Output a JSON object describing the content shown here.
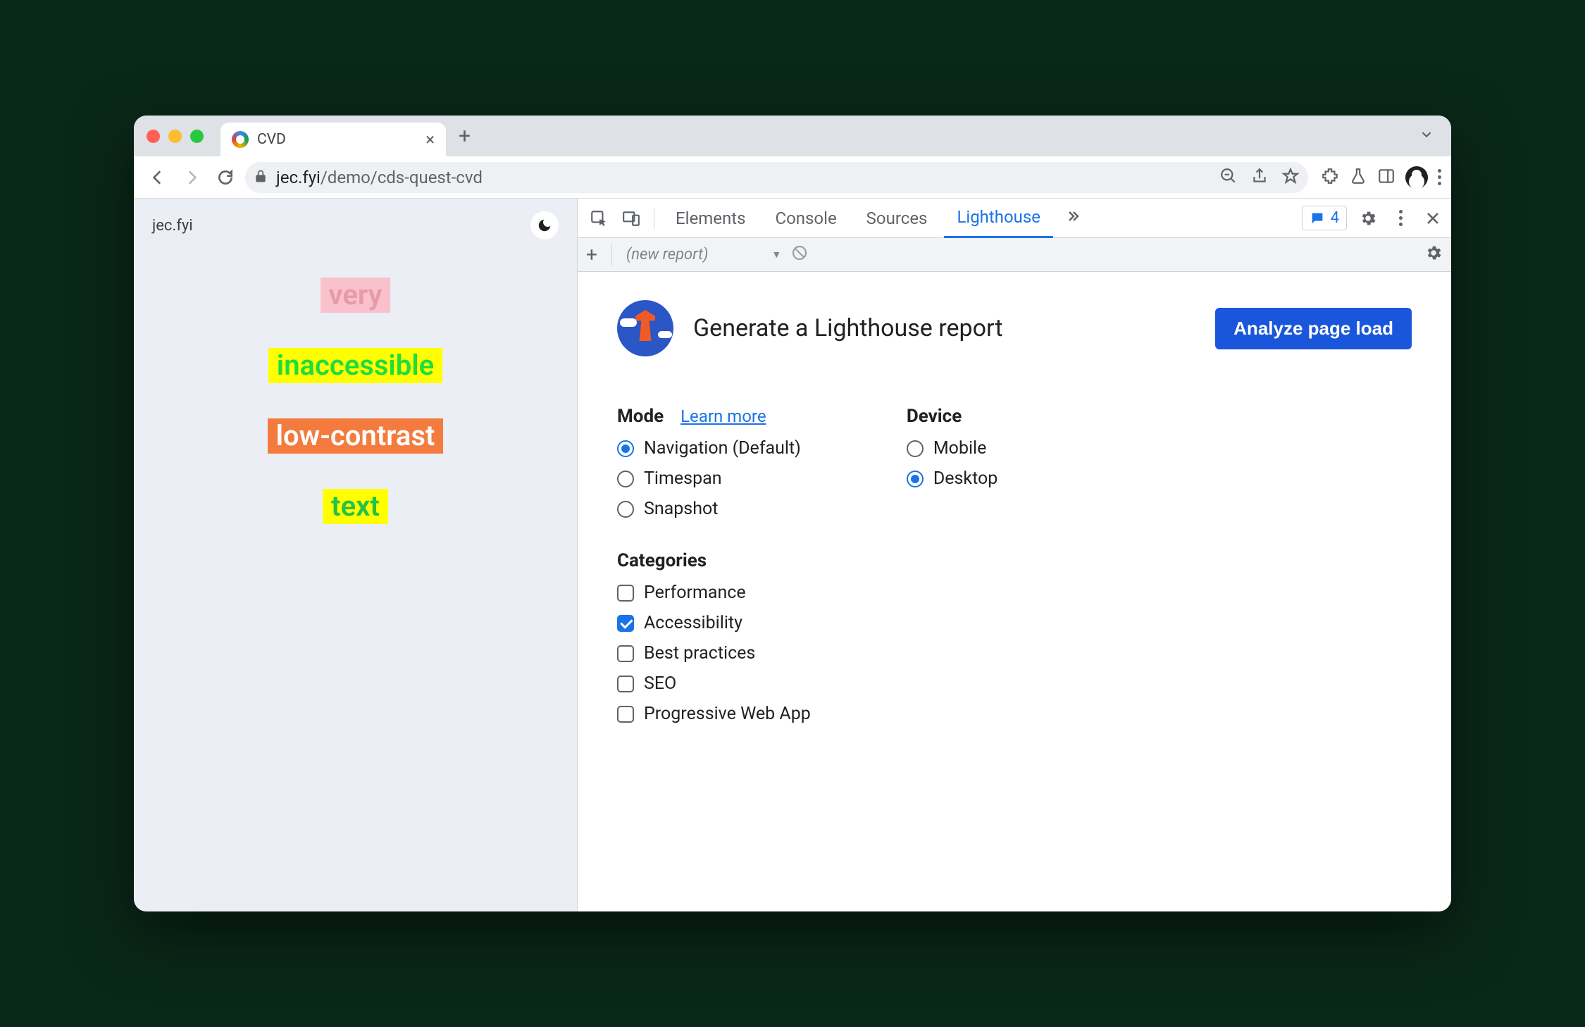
{
  "browser": {
    "tab_title": "CVD",
    "url_host": "jec.fyi",
    "url_path": "/demo/cds-quest-cvd"
  },
  "page": {
    "site_label": "jec.fyi",
    "demo_words": [
      "very",
      "inaccessible",
      "low-contrast",
      "text"
    ]
  },
  "devtools": {
    "tabs": [
      "Elements",
      "Console",
      "Sources",
      "Lighthouse"
    ],
    "active_tab": "Lighthouse",
    "issues_count": "4",
    "report_dropdown": "(new report)"
  },
  "lighthouse": {
    "heading": "Generate a Lighthouse report",
    "analyze_label": "Analyze page load",
    "mode_label": "Mode",
    "learn_more": "Learn more",
    "modes": [
      {
        "label": "Navigation (Default)",
        "checked": true
      },
      {
        "label": "Timespan",
        "checked": false
      },
      {
        "label": "Snapshot",
        "checked": false
      }
    ],
    "device_label": "Device",
    "devices": [
      {
        "label": "Mobile",
        "checked": false
      },
      {
        "label": "Desktop",
        "checked": true
      }
    ],
    "categories_label": "Categories",
    "categories": [
      {
        "label": "Performance",
        "checked": false
      },
      {
        "label": "Accessibility",
        "checked": true
      },
      {
        "label": "Best practices",
        "checked": false
      },
      {
        "label": "SEO",
        "checked": false
      },
      {
        "label": "Progressive Web App",
        "checked": false
      }
    ]
  }
}
